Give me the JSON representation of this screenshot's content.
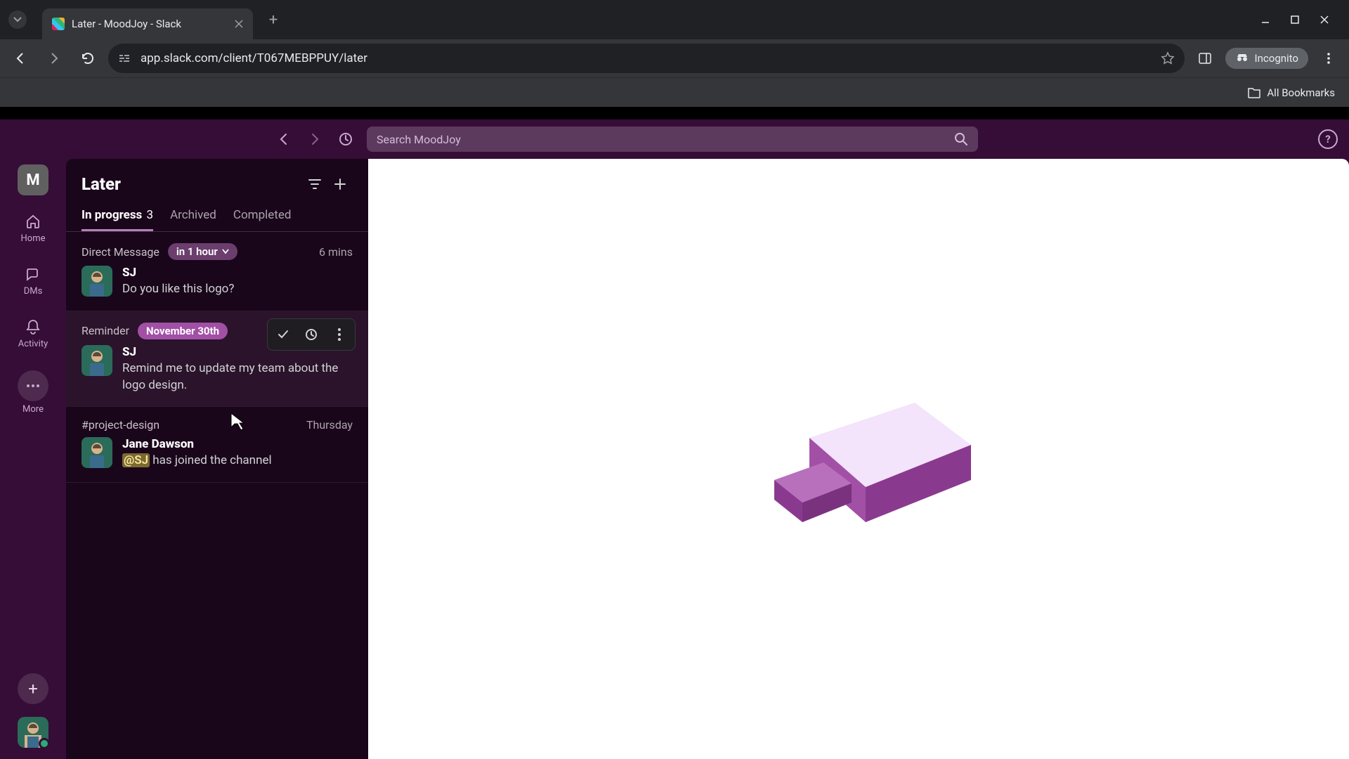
{
  "browser": {
    "tab_title": "Later - MoodJoy - Slack",
    "url": "app.slack.com/client/T067MEBPPUY/later",
    "all_bookmarks": "All Bookmarks",
    "incognito": "Incognito"
  },
  "slack_header": {
    "search_placeholder": "Search MoodJoy"
  },
  "rail": {
    "workspace_letter": "M",
    "home": "Home",
    "dms": "DMs",
    "activity": "Activity",
    "more": "More"
  },
  "later": {
    "title": "Later",
    "tabs": {
      "in_progress_label": "In progress",
      "in_progress_count": "3",
      "archived": "Archived",
      "completed": "Completed"
    },
    "items": [
      {
        "context": "Direct Message",
        "due": "in 1 hour",
        "time": "6 mins",
        "author": "SJ",
        "text": "Do you like this logo?"
      },
      {
        "context": "Reminder",
        "due": "November 30th",
        "time_hidden": "w",
        "author": "SJ",
        "text": "Remind me to update my team about the logo design."
      },
      {
        "context": "#project-design",
        "time": "Thursday",
        "author": "Jane Dawson",
        "mention": "@SJ",
        "text_after": " has joined the channel"
      }
    ]
  }
}
